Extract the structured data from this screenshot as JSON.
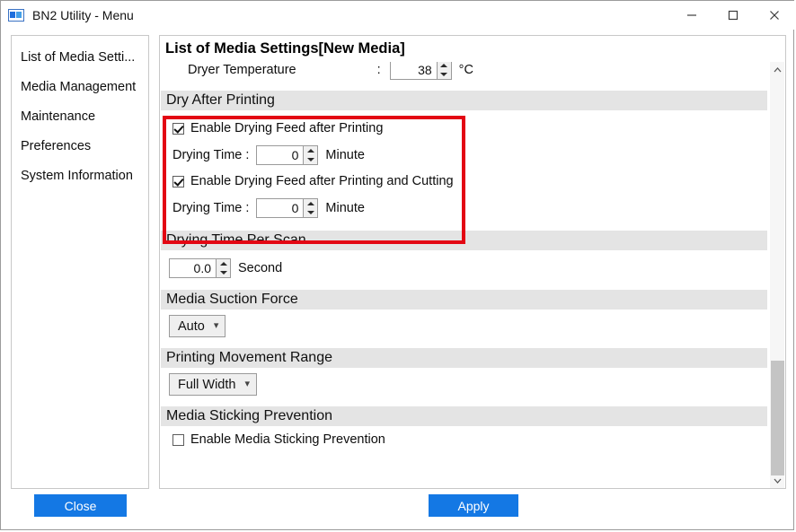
{
  "window": {
    "title": "BN2 Utility - Menu",
    "app_icon": "bn2-app-icon",
    "controls": {
      "minimize": "minimize-icon",
      "maximize": "maximize-icon",
      "close": "close-icon"
    }
  },
  "sidebar": {
    "items": [
      {
        "label": "List of Media Setti..."
      },
      {
        "label": "Media Management"
      },
      {
        "label": "Maintenance"
      },
      {
        "label": "Preferences"
      },
      {
        "label": "System Information"
      }
    ],
    "close_label": "Close"
  },
  "main": {
    "title": "List of Media Settings[New Media]",
    "apply_label": "Apply",
    "dryer_temperature": {
      "label": "Dryer Temperature",
      "separator": ":",
      "value": "38",
      "unit": "°C"
    },
    "sections": [
      {
        "header": "Dry After Printing",
        "checkbox1": {
          "label": "Enable Drying Feed after Printing",
          "checked": true
        },
        "drying_time1": {
          "label": "Drying Time :",
          "value": "0",
          "unit": "Minute"
        },
        "checkbox2": {
          "label": "Enable Drying Feed after Printing and Cutting",
          "checked": true
        },
        "drying_time2": {
          "label": "Drying Time :",
          "value": "0",
          "unit": "Minute"
        }
      },
      {
        "header": "Drying Time Per Scan",
        "value": "0.0",
        "unit": "Second"
      },
      {
        "header": "Media Suction Force",
        "selected": "Auto"
      },
      {
        "header": "Printing Movement Range",
        "selected": "Full Width"
      },
      {
        "header": "Media Sticking Prevention",
        "checkbox": {
          "label": "Enable Media Sticking Prevention",
          "checked": false
        }
      }
    ]
  },
  "scrollbar": {
    "up_arrow": "chevron-up-icon",
    "down_arrow": "chevron-down-icon"
  },
  "colors": {
    "accent_blue": "#1478e4",
    "highlight_red": "#e30613",
    "section_header_bg": "#e4e4e4"
  }
}
